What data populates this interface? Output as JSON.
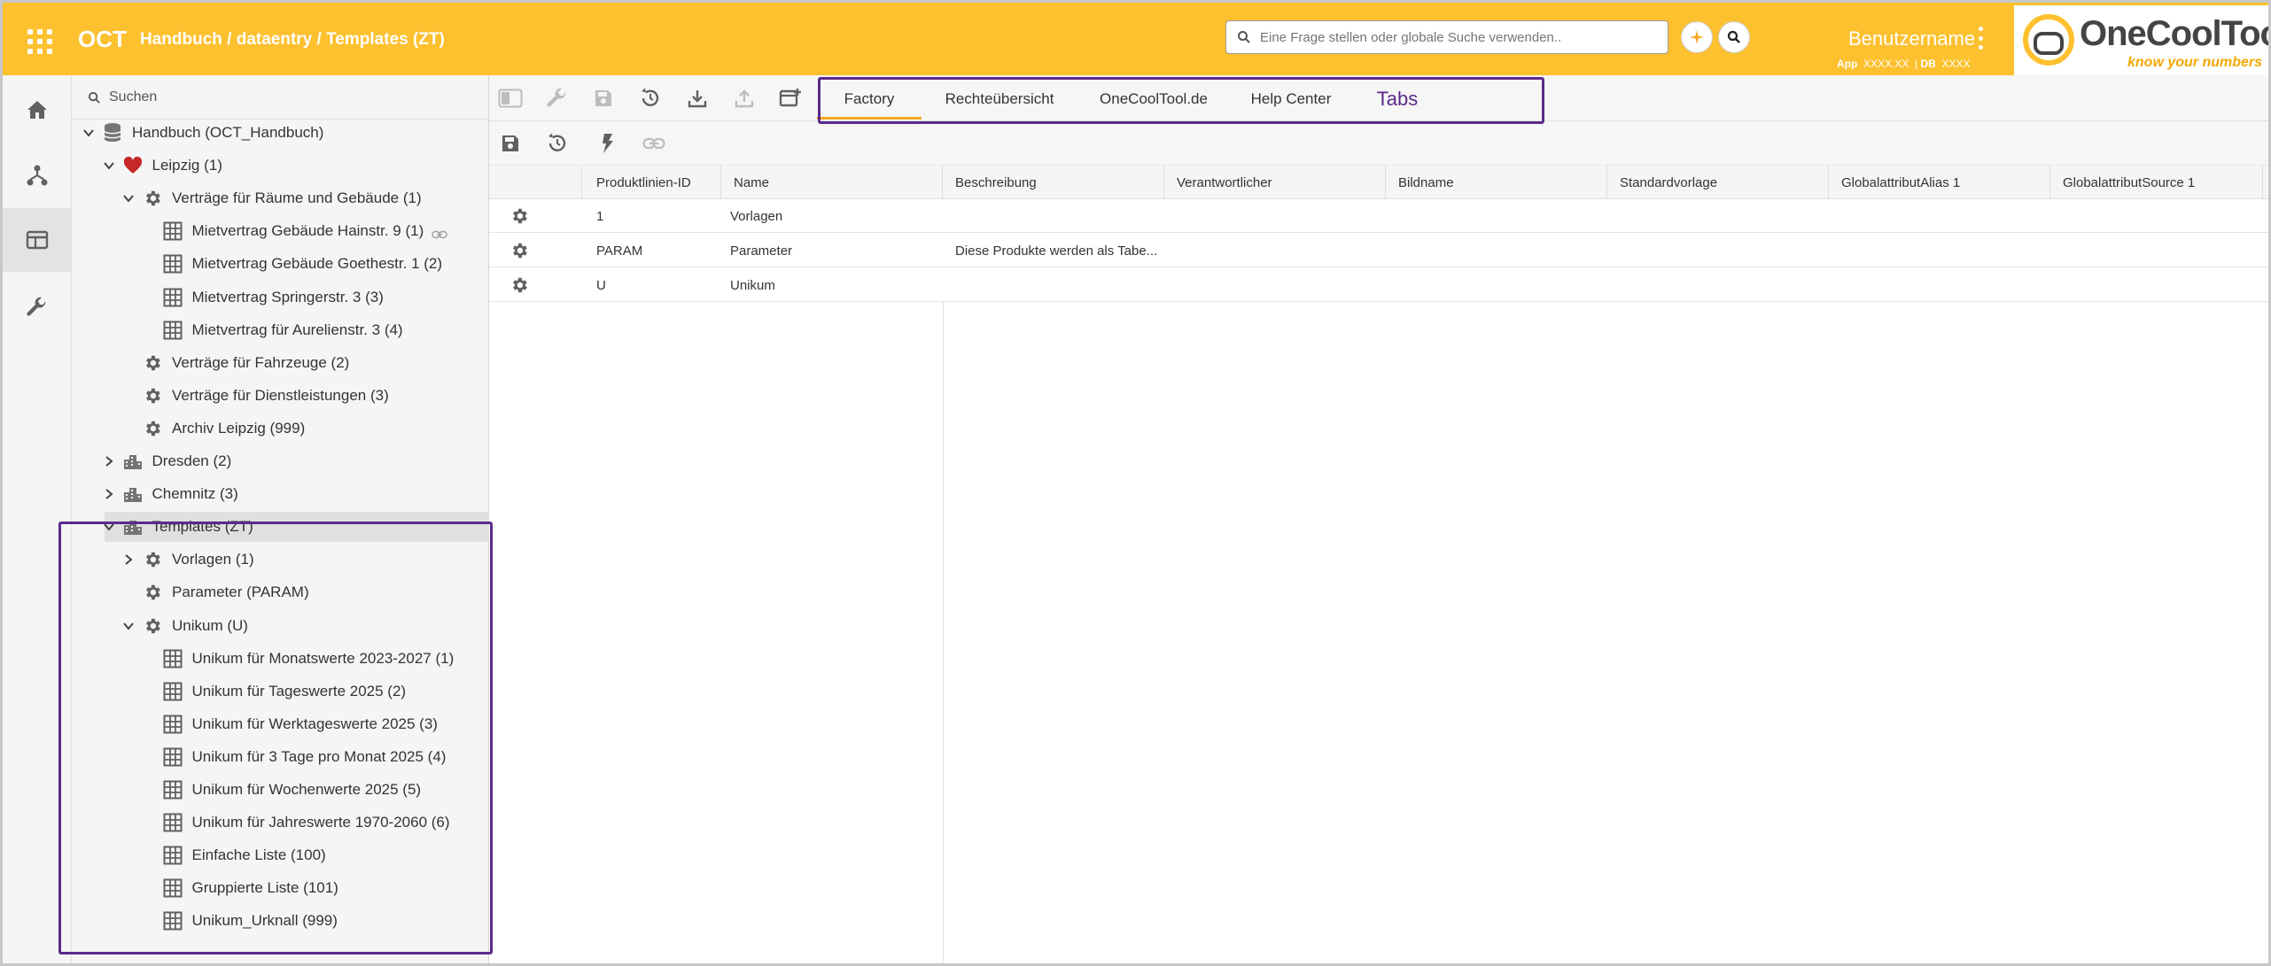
{
  "header": {
    "app_name": "OCT",
    "breadcrumb": "Handbuch / dataentry / Templates (ZT)",
    "search_placeholder": "Eine Frage stellen oder globale Suche verwenden..",
    "user_name": "Benutzername",
    "env_app_label": "App",
    "env_app_value": "XXXX.XX",
    "env_db_label": "DB",
    "env_db_value": "XXXX",
    "logo_text": "OneCoolTool",
    "logo_slogan": "know your numbers",
    "accent_color": "#fdc12f"
  },
  "rail": {
    "items": [
      {
        "icon": "home-icon"
      },
      {
        "icon": "hierarchy-icon"
      },
      {
        "icon": "table-view-icon",
        "active": true
      },
      {
        "icon": "wrench-icon"
      }
    ]
  },
  "tree": {
    "search_placeholder": "Suchen",
    "nodes": [
      {
        "label": "Handbuch (OCT_Handbuch)",
        "icon": "database-icon",
        "chevron": "down",
        "level": 0
      },
      {
        "label": "Leipzig (1)",
        "icon": "heart-icon",
        "chevron": "down",
        "level": 1
      },
      {
        "label": "Verträge für Räume und Gebäude (1)",
        "icon": "gear-icon",
        "chevron": "down",
        "level": 2
      },
      {
        "label": "Mietvertrag Gebäude Hainstr. 9 (1)",
        "icon": "grid-table-icon",
        "chevron": "",
        "level": 3,
        "linked": true
      },
      {
        "label": "Mietvertrag Gebäude Goethestr. 1 (2)",
        "icon": "grid-table-icon",
        "chevron": "",
        "level": 3
      },
      {
        "label": "Mietvertrag Springerstr. 3 (3)",
        "icon": "grid-table-icon",
        "chevron": "",
        "level": 3
      },
      {
        "label": "Mietvertrag für Aurelienstr. 3 (4)",
        "icon": "grid-table-icon",
        "chevron": "",
        "level": 3
      },
      {
        "label": "Verträge für Fahrzeuge (2)",
        "icon": "gear-icon",
        "chevron": "",
        "level": 2
      },
      {
        "label": "Verträge für Dienstleistungen (3)",
        "icon": "gear-icon",
        "chevron": "",
        "level": 2
      },
      {
        "label": "Archiv Leipzig (999)",
        "icon": "gear-icon",
        "chevron": "",
        "level": 2
      },
      {
        "label": "Dresden (2)",
        "icon": "buildings-icon",
        "chevron": "right",
        "level": 1
      },
      {
        "label": "Chemnitz (3)",
        "icon": "buildings-icon",
        "chevron": "right",
        "level": 1
      },
      {
        "label": "Templates (ZT)",
        "icon": "buildings-icon",
        "chevron": "down",
        "level": 1,
        "selected": true
      },
      {
        "label": "Vorlagen (1)",
        "icon": "gear-icon",
        "chevron": "right",
        "level": 2
      },
      {
        "label": "Parameter (PARAM)",
        "icon": "gear-icon",
        "chevron": "",
        "level": 2
      },
      {
        "label": "Unikum (U)",
        "icon": "gear-icon",
        "chevron": "down",
        "level": 2
      },
      {
        "label": "Unikum für Monatswerte 2023-2027 (1)",
        "icon": "grid-table-icon",
        "chevron": "",
        "level": 3
      },
      {
        "label": "Unikum für Tageswerte 2025 (2)",
        "icon": "grid-table-icon",
        "chevron": "",
        "level": 3
      },
      {
        "label": "Unikum für Werktageswerte 2025 (3)",
        "icon": "grid-table-icon",
        "chevron": "",
        "level": 3
      },
      {
        "label": "Unikum für 3 Tage pro Monat 2025 (4)",
        "icon": "grid-table-icon",
        "chevron": "",
        "level": 3
      },
      {
        "label": "Unikum für Wochenwerte 2025 (5)",
        "icon": "grid-table-icon",
        "chevron": "",
        "level": 3
      },
      {
        "label": "Unikum für Jahreswerte 1970-2060 (6)",
        "icon": "grid-table-icon",
        "chevron": "",
        "level": 3
      },
      {
        "label": "Einfache Liste (100)",
        "icon": "grid-table-icon",
        "chevron": "",
        "level": 3
      },
      {
        "label": "Gruppierte Liste (101)",
        "icon": "grid-table-icon",
        "chevron": "",
        "level": 3
      },
      {
        "label": "Unikum_Urknall (999)",
        "icon": "grid-table-icon",
        "chevron": "",
        "level": 3
      }
    ]
  },
  "toolbar": {
    "buttons": [
      "panel-toggle-icon",
      "wrench-icon",
      "save-icon",
      "history-icon",
      "download-icon",
      "upload-icon",
      "add-window-icon"
    ],
    "secondary_buttons": [
      "save-icon",
      "history-icon",
      "lightning-icon",
      "link-icon"
    ]
  },
  "tabs": [
    {
      "label": "Factory",
      "active": true
    },
    {
      "label": "Rechteübersicht"
    },
    {
      "label": "OneCoolTool.de"
    },
    {
      "label": "Help Center"
    },
    {
      "label": "Tabs",
      "note": true
    }
  ],
  "grid": {
    "columns": [
      "Produktlinien-ID",
      "Name",
      "Beschreibung",
      "Verantwortlicher",
      "Bildname",
      "Standardvorlage",
      "GlobalattributAlias 1",
      "GlobalattributSource 1"
    ],
    "rows": [
      {
        "id": "1",
        "name": "Vorlagen",
        "beschreibung": ""
      },
      {
        "id": "PARAM",
        "name": "Parameter",
        "beschreibung": "Diese Produkte werden als Tabe..."
      },
      {
        "id": "U",
        "name": "Unikum",
        "beschreibung": ""
      }
    ]
  },
  "highlight_color": "#5a2a8a"
}
